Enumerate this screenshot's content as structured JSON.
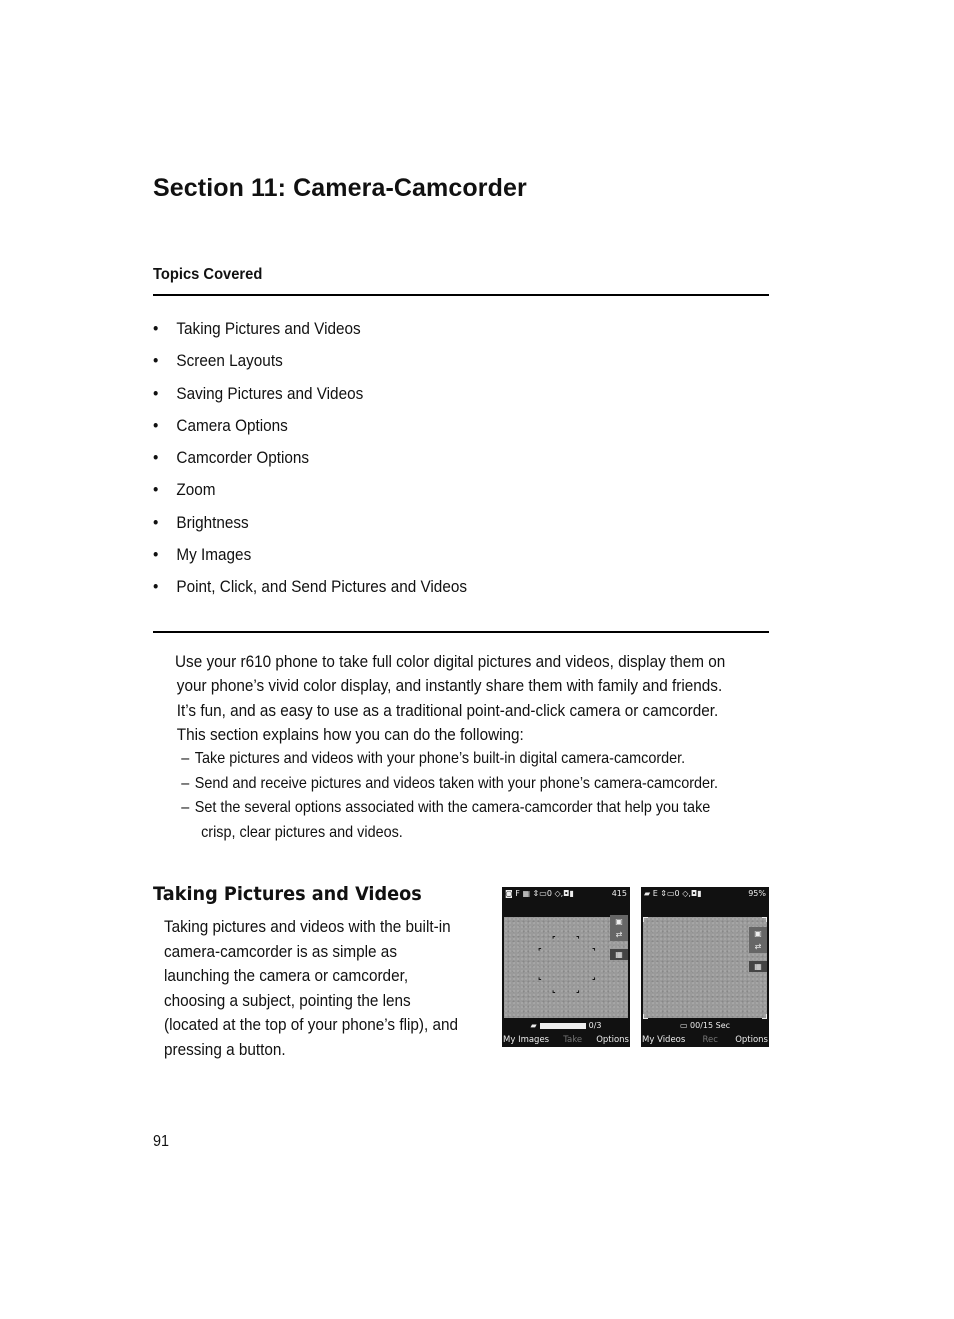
{
  "page": {
    "title": "Section 11:  Camera-Camcorder",
    "page_number": "91"
  },
  "topics": {
    "heading": "Topics Covered",
    "bullet": "•",
    "items": [
      "Taking Pictures and Videos",
      "Screen Layouts",
      "Saving Pictures and Videos",
      "Camera Options",
      "Camcorder Options",
      "Zoom",
      "Brightness",
      "My Images",
      "Point, Click, and Send Pictures and Videos"
    ]
  },
  "intro": {
    "lines": [
      "Use your r610 phone to take full color digital pictures and videos, display them on",
      "your phone’s vivid color display, and instantly share them with family and friends.",
      "It’s fun, and as easy to use as a traditional point-and-click camera or camcorder.",
      "This section explains how you can do the following:"
    ],
    "dash": "–",
    "list": [
      {
        "text": "Take pictures and videos with your phone’s built-in digital camera-camcorder.",
        "cont": ""
      },
      {
        "text": "Send and receive pictures and videos taken with your phone’s camera-camcorder.",
        "cont": ""
      },
      {
        "text": "Set the several options associated with the camera-camcorder that help you take",
        "cont": "crisp, clear pictures and videos."
      }
    ]
  },
  "taking_section": {
    "heading": "Taking Pictures and Videos",
    "lines": [
      "Taking pictures and videos with the built-in",
      "camera-camcorder is as simple as",
      "launching the camera or camcorder,",
      "choosing a subject, pointing the lens",
      "(located at the top of your phone’s flip), and",
      "pressing a button."
    ]
  },
  "camera_screen": {
    "status_left": "◙ F ▦ ⇕▭0 ◇,◘▮",
    "status_right": "415",
    "counter": "0/3",
    "softkeys": [
      "My Images",
      "Take",
      "Options"
    ]
  },
  "camcorder_screen": {
    "status_left": "▰ E ⇕▭0 ◇,◘▮",
    "status_right": "95%",
    "timer": "00/15 Sec",
    "softkeys": [
      "My Videos",
      "Rec",
      "Options"
    ]
  }
}
